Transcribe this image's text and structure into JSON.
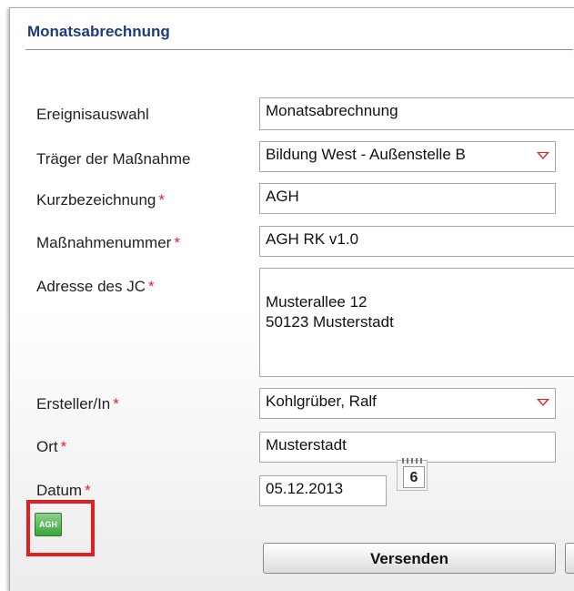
{
  "form": {
    "title": "Monatsabrechnung",
    "fields": {
      "ereignis": {
        "label": "Ereignisauswahl",
        "value": "Monatsabrechnung"
      },
      "traeger": {
        "label": "Träger der Maßnahme",
        "value": "Bildung West - Außenstelle B"
      },
      "kurz": {
        "label": "Kurzbezeichnung",
        "required": "*",
        "value": "AGH"
      },
      "massnahme": {
        "label": "Maßnahmenummer",
        "required": "*",
        "value": "AGH RK v1.0"
      },
      "adresse": {
        "label": "Adresse des JC",
        "required": "*",
        "value": "Musterallee 12\n50123 Musterstadt"
      },
      "ersteller": {
        "label": "Ersteller/In",
        "required": "*",
        "value": "Kohlgrüber, Ralf"
      },
      "ort": {
        "label": "Ort",
        "required": "*",
        "value": "Musterstadt"
      },
      "datum": {
        "label": "Datum",
        "required": "*",
        "value": "05.12.2013"
      }
    },
    "calendar_day": "6",
    "agh_icon_text": "AGH",
    "send_label": "Versenden"
  },
  "colors": {
    "title": "#1f3a7e",
    "required_star": "#e0232c",
    "highlight_box": "#e02020",
    "dropdown_arrow": "#e0232c"
  },
  "icons": {
    "dropdown": "red-triangle-down",
    "calendar": "calendar-icon",
    "agh_document": "agh-document-icon"
  }
}
